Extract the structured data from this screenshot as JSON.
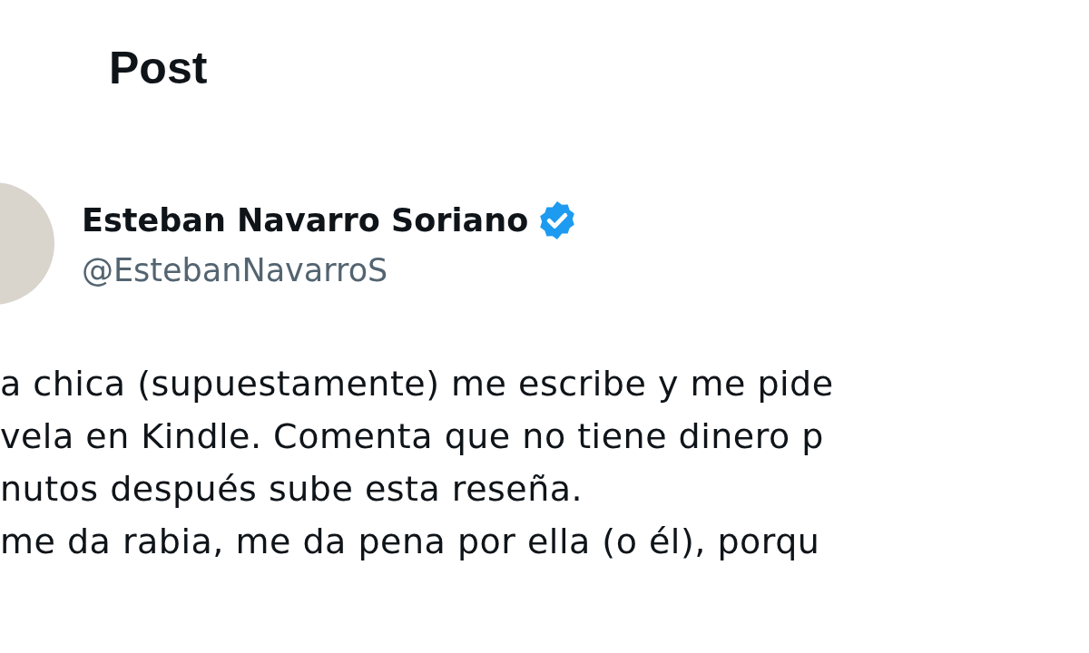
{
  "header": {
    "title": "Post"
  },
  "author": {
    "name": "Esteban Navarro Soriano",
    "verified": true,
    "handle": "@EstebanNavarroS"
  },
  "body_lines": [
    "a chica (supuestamente) me escribe y me pide",
    "vela en Kindle. Comenta que no tiene dinero p",
    "nutos después sube esta reseña.",
    "me da rabia, me da pena por ella (o él), porqu"
  ]
}
